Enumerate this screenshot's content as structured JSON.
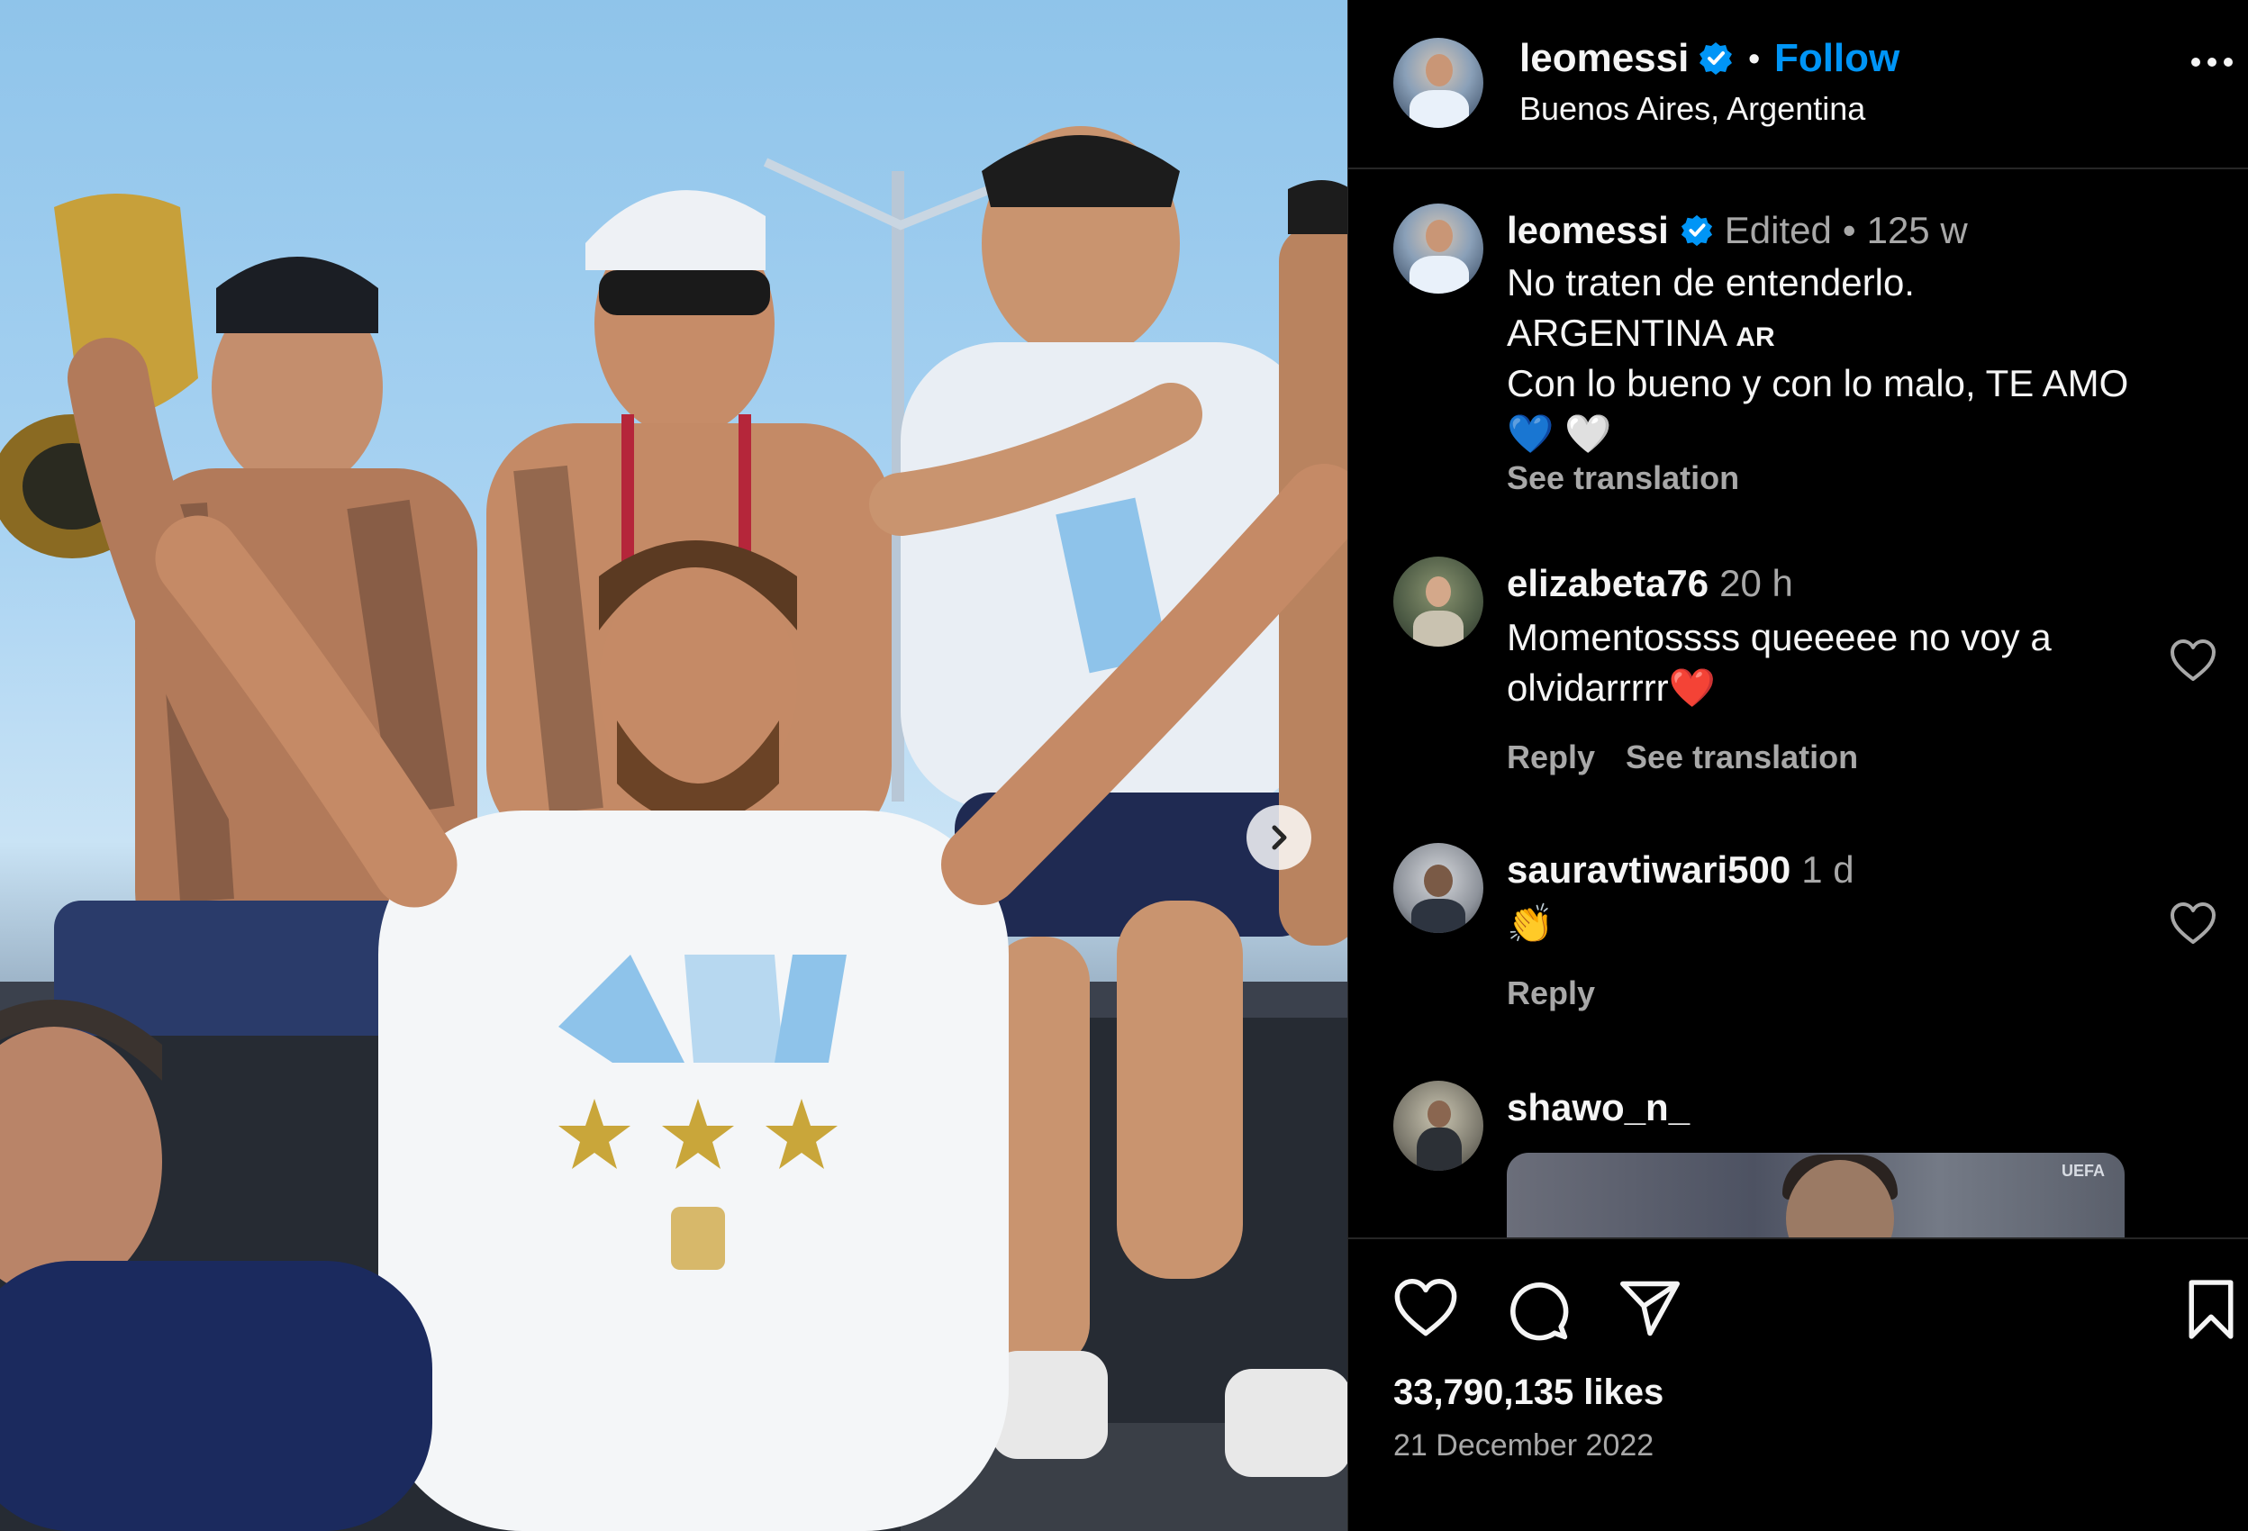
{
  "post": {
    "username": "leomessi",
    "verified": true,
    "header_separator": "•",
    "follow_label": "Follow",
    "location": "Buenos Aires, Argentina",
    "more_icon": "more-horizontal-icon"
  },
  "caption": {
    "username": "leomessi",
    "edited_label": "Edited",
    "separator": "•",
    "age": "125 w",
    "lines": [
      "No traten de entenderlo.",
      "ARGENTINA",
      "Con lo bueno y con lo malo, TE AMO"
    ],
    "flag_text": "AR",
    "emojis": [
      "💙",
      "🤍"
    ],
    "see_translation": "See translation"
  },
  "comments": [
    {
      "username": "elizabeta76",
      "age": "20 h",
      "text_line1": "Momentossss queeeee no voy a",
      "text_line2": "olvidarrrrr",
      "emoji": "❤️",
      "reply_label": "Reply",
      "see_translation": "See translation"
    },
    {
      "username": "sauravtiwari500",
      "age": "1 d",
      "text": "👏",
      "reply_label": "Reply"
    },
    {
      "username": "shawo_n_",
      "preview_badge": "UEFA"
    }
  ],
  "footer": {
    "likes": "33,790,135 likes",
    "date": "21 December 2022"
  },
  "colors": {
    "background": "#000000",
    "text": "#f5f5f5",
    "muted": "#a8a8a8",
    "link": "#0095f6",
    "verified": "#0095f6",
    "divider": "#262626"
  }
}
